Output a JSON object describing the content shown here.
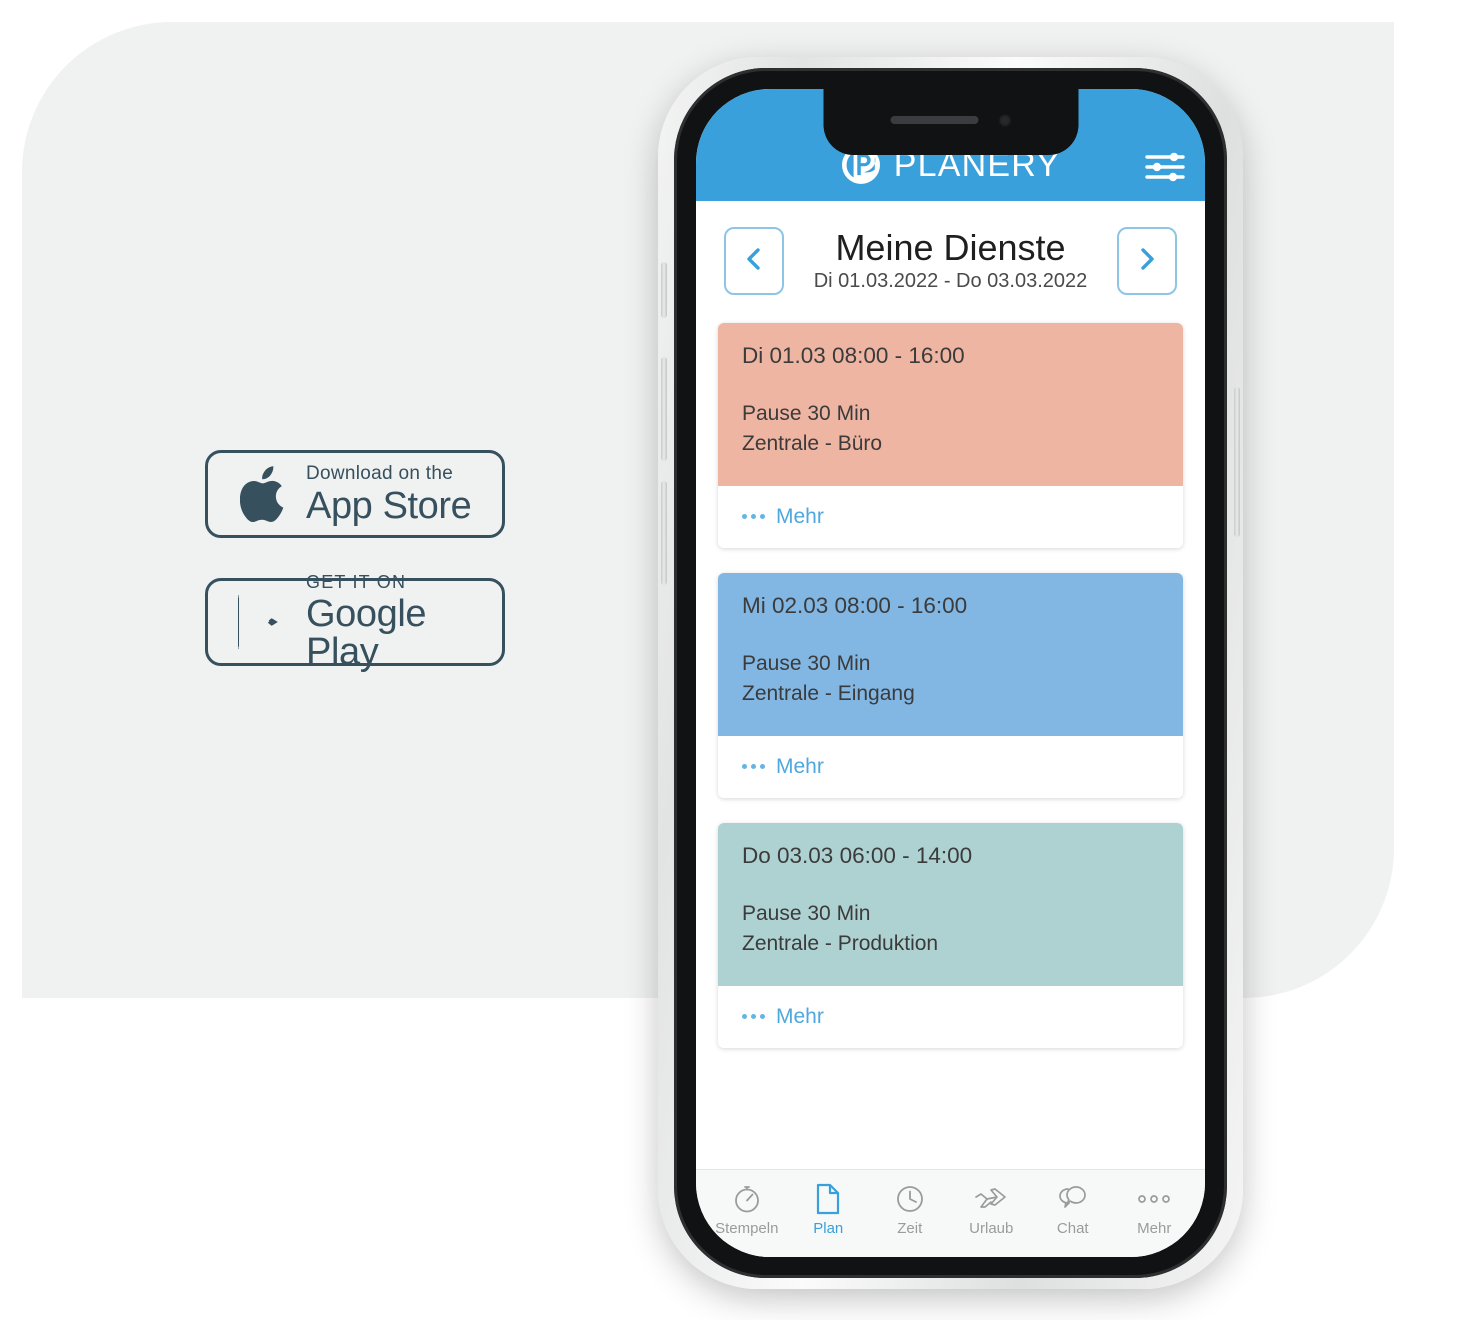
{
  "store_badges": [
    {
      "icon": "apple-logo-icon",
      "small_label": "Download on the",
      "big_label": "App Store"
    },
    {
      "icon": "google-play-logo-icon",
      "small_label": "GET IT ON",
      "big_label": "Google Play"
    }
  ],
  "app": {
    "header": {
      "logo_icon": "planery-logo-icon",
      "brand_name": "PLANERY",
      "settings_icon": "sliders-settings-icon",
      "background_color": "#3AA0DB"
    },
    "title_bar": {
      "prev_icon": "chevron-left-icon",
      "next_icon": "chevron-right-icon",
      "title": "Meine Dienste",
      "date_range": "Di 01.03.2022 - Do 03.03.2022"
    },
    "shifts": [
      {
        "time": "Di 01.03 08:00 - 16:00",
        "break": "Pause 30 Min",
        "location": "Zentrale - Büro",
        "color": "#EEB5A3",
        "more_label": "Mehr",
        "more_icon": "ellipsis-icon"
      },
      {
        "time": "Mi 02.03 08:00 - 16:00",
        "break": "Pause 30 Min",
        "location": "Zentrale - Eingang",
        "color": "#82B6E3",
        "more_label": "Mehr",
        "more_icon": "ellipsis-icon"
      },
      {
        "time": "Do 03.03 06:00 - 14:00",
        "break": "Pause 30 Min",
        "location": "Zentrale - Produktion",
        "color": "#AED2D2",
        "more_label": "Mehr",
        "more_icon": "ellipsis-icon"
      }
    ],
    "tabbar": {
      "active_color": "#3AA0DB",
      "inactive_color": "#9B9B9B",
      "items": [
        {
          "label": "Stempeln",
          "icon": "stopwatch-icon",
          "active": false
        },
        {
          "label": "Plan",
          "icon": "document-icon",
          "active": true
        },
        {
          "label": "Zeit",
          "icon": "clock-icon",
          "active": false
        },
        {
          "label": "Urlaub",
          "icon": "airplane-icon",
          "active": false
        },
        {
          "label": "Chat",
          "icon": "chat-bubbles-icon",
          "active": false
        },
        {
          "label": "Mehr",
          "icon": "ellipsis-icon",
          "active": false
        }
      ]
    }
  }
}
